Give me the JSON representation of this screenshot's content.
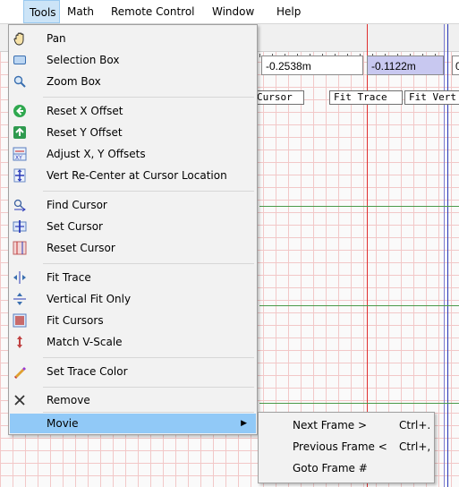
{
  "menubar": {
    "items": [
      {
        "label": "Tools"
      },
      {
        "label": "Math"
      },
      {
        "label": "Remote Control"
      },
      {
        "label": "Window"
      },
      {
        "label": "Help"
      }
    ]
  },
  "plot": {
    "x_box_left": "-0.2538m",
    "x_box_cursor": "-0.1122m",
    "x_box_right": "0",
    "buttons": {
      "cursor": "Cursor",
      "fit_trace": "Fit Trace",
      "fit_vert": "Fit Vert"
    },
    "colors": {
      "grid": "#f2c8c8",
      "cursor_red": "#e03030",
      "cursor_blue": "#2a3ab8",
      "green": "#4a9a4a"
    }
  },
  "tools_menu": {
    "items": [
      {
        "label": "Pan",
        "icon": "hand-icon"
      },
      {
        "label": "Selection Box",
        "icon": "selection-box-icon"
      },
      {
        "label": "Zoom Box",
        "icon": "zoom-icon"
      },
      {
        "label": "Reset X Offset",
        "icon": "left-arrow-circle-icon"
      },
      {
        "label": "Reset Y Offset",
        "icon": "up-arrow-square-icon"
      },
      {
        "label": "Adjust X, Y Offsets",
        "icon": "xy-offset-icon"
      },
      {
        "label": "Vert Re-Center at Cursor Location",
        "icon": "vert-recenter-icon"
      },
      {
        "label": "Find Cursor",
        "icon": "find-cursor-icon"
      },
      {
        "label": "Set Cursor",
        "icon": "set-cursor-icon"
      },
      {
        "label": "Reset Cursor",
        "icon": "reset-cursor-icon"
      },
      {
        "label": "Fit Trace",
        "icon": "fit-trace-icon"
      },
      {
        "label": "Vertical Fit Only",
        "icon": "vertical-fit-icon"
      },
      {
        "label": "Fit Cursors",
        "icon": "fit-cursors-icon"
      },
      {
        "label": "Match V-Scale",
        "icon": "match-vscale-icon"
      },
      {
        "label": "Set Trace Color",
        "icon": "color-pen-icon"
      },
      {
        "label": "Remove",
        "icon": "close-icon"
      },
      {
        "label": "Movie",
        "icon": ""
      }
    ]
  },
  "movie_submenu": {
    "items": [
      {
        "label": "Next Frame >",
        "shortcut": "Ctrl+."
      },
      {
        "label": "Previous Frame <",
        "shortcut": "Ctrl+,"
      },
      {
        "label": "Goto Frame #",
        "shortcut": ""
      }
    ]
  }
}
